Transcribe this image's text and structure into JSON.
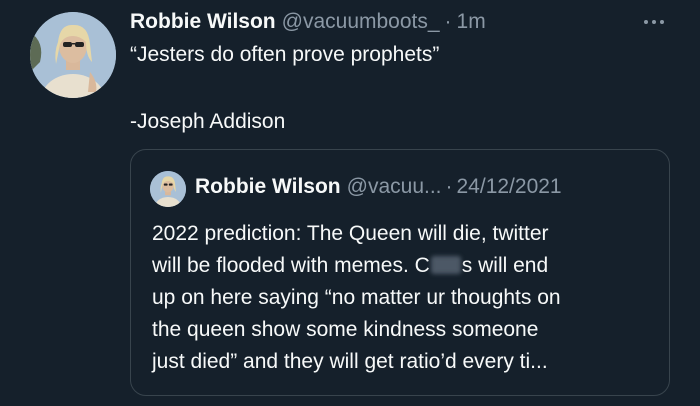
{
  "tweet": {
    "author_name": "Robbie Wilson",
    "author_handle": "@vacuumboots_",
    "separator": "·",
    "time": "1m",
    "text_line1": "“Jesters do often prove prophets”",
    "text_line2": "-Joseph Addison"
  },
  "quoted": {
    "author_name": "Robbie Wilson",
    "author_handle": "@vacuu...",
    "separator": "·",
    "date": "24/12/2021",
    "line1": "2022 prediction:  The Queen will die, twitter",
    "line2_a": "will be flooded with memes.  C",
    "line2_b": "s will end",
    "line3": "up on here saying “no matter ur thoughts on",
    "line4": "the queen show some kindness someone",
    "line5": "just died” and they will get ratio’d every ti..."
  },
  "icons": {
    "more": "more-horizontal-icon",
    "avatar": "profile-photo"
  },
  "colors": {
    "background": "#15202b",
    "text": "#f7f9f9",
    "secondary_text": "#8b98a5",
    "border": "#38444d"
  }
}
